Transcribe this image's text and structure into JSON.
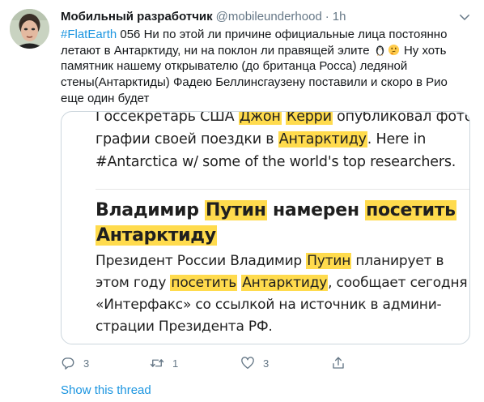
{
  "colors": {
    "link": "#1b95e0",
    "secondary_text": "#657786",
    "highlight": "#ffdb4d",
    "media_border": "#ccd6dd"
  },
  "author": {
    "name": "Мобильный разработчик",
    "handle": "@mobileunderhood",
    "separator": "·",
    "time": "1h"
  },
  "tweet": {
    "hashtag": "#FlatEarth",
    "text_part1": " 056 Ни по этой ли причине официальные лица постоянно летают в Антарктиду, ни на поклон ли правящей элите ",
    "emoji_1": "penguin-icon",
    "emoji_2": "thinking-face-icon",
    "text_part2": " Ну хоть памятник нашему открывателю (до британца Росса) ледяной стены(Антарктиды) Фадею Беллинсгаузену поставили и скоро в Рио еще один будет"
  },
  "media": {
    "snippet": {
      "l1_pre": "Госсекретарь США ",
      "l1_hl1": "Джон",
      "l1_sp": " ",
      "l1_hl2": "Керри",
      "l1_post": " опубликовал фото-",
      "l2_pre": "графии своей поездки в ",
      "l2_hl": "Антарктиду",
      "l2_post": ". Here in",
      "l3": "#Antarctica w/ some of the world's top researchers."
    },
    "headline": {
      "pre": "Владимир ",
      "hl1": "Путин",
      "mid": " намерен ",
      "hl2": "посетить",
      "hl3": "Антарктиду"
    },
    "body": {
      "l1_pre": "Президент России Владимир ",
      "l1_hl": "Путин",
      "l1_post": " планирует в",
      "l2_pre": "этом году ",
      "l2_hl1": "посетить",
      "l2_sp": " ",
      "l2_hl2": "Антарктиду",
      "l2_post": ", сообщает сегодня",
      "l3": "«Интерфакс» со ссылкой на источник в админи-",
      "l4": "страции Президента РФ."
    }
  },
  "actions": {
    "reply_count": "3",
    "retweet_count": "1",
    "like_count": "3"
  },
  "show_thread": "Show this thread"
}
